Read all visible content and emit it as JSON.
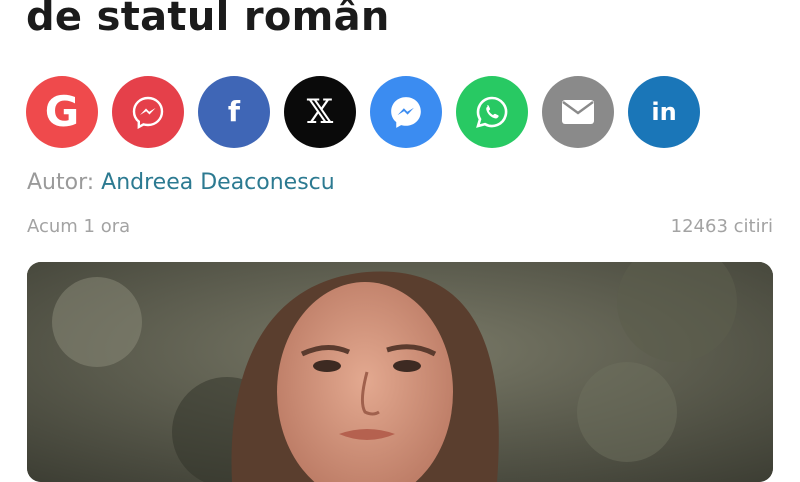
{
  "article": {
    "title_fragment": "de statul român",
    "author_label": "Autor:",
    "author_name": "Andreea Deaconescu",
    "timestamp": "Acum 1 ora",
    "reads": "12463 citiri"
  },
  "share": [
    {
      "name": "google-news",
      "icon": "google-g-icon",
      "color": "#ef4a4c"
    },
    {
      "name": "messenger-red",
      "icon": "messenger-icon",
      "color": "#e5404a"
    },
    {
      "name": "facebook",
      "icon": "facebook-f-icon",
      "color": "#3f66b6"
    },
    {
      "name": "x",
      "icon": "x-logo-icon",
      "color": "#0a0a0a"
    },
    {
      "name": "messenger",
      "icon": "messenger-icon",
      "color": "#3b8cf1"
    },
    {
      "name": "whatsapp",
      "icon": "whatsapp-icon",
      "color": "#28c963"
    },
    {
      "name": "email",
      "icon": "envelope-icon",
      "color": "#8a8a8a"
    },
    {
      "name": "linkedin",
      "icon": "linkedin-icon",
      "color": "#1a76b8"
    }
  ],
  "share_glyphs": {
    "google": "G",
    "facebook": "f",
    "x": "𝕏",
    "linkedin": "in"
  }
}
